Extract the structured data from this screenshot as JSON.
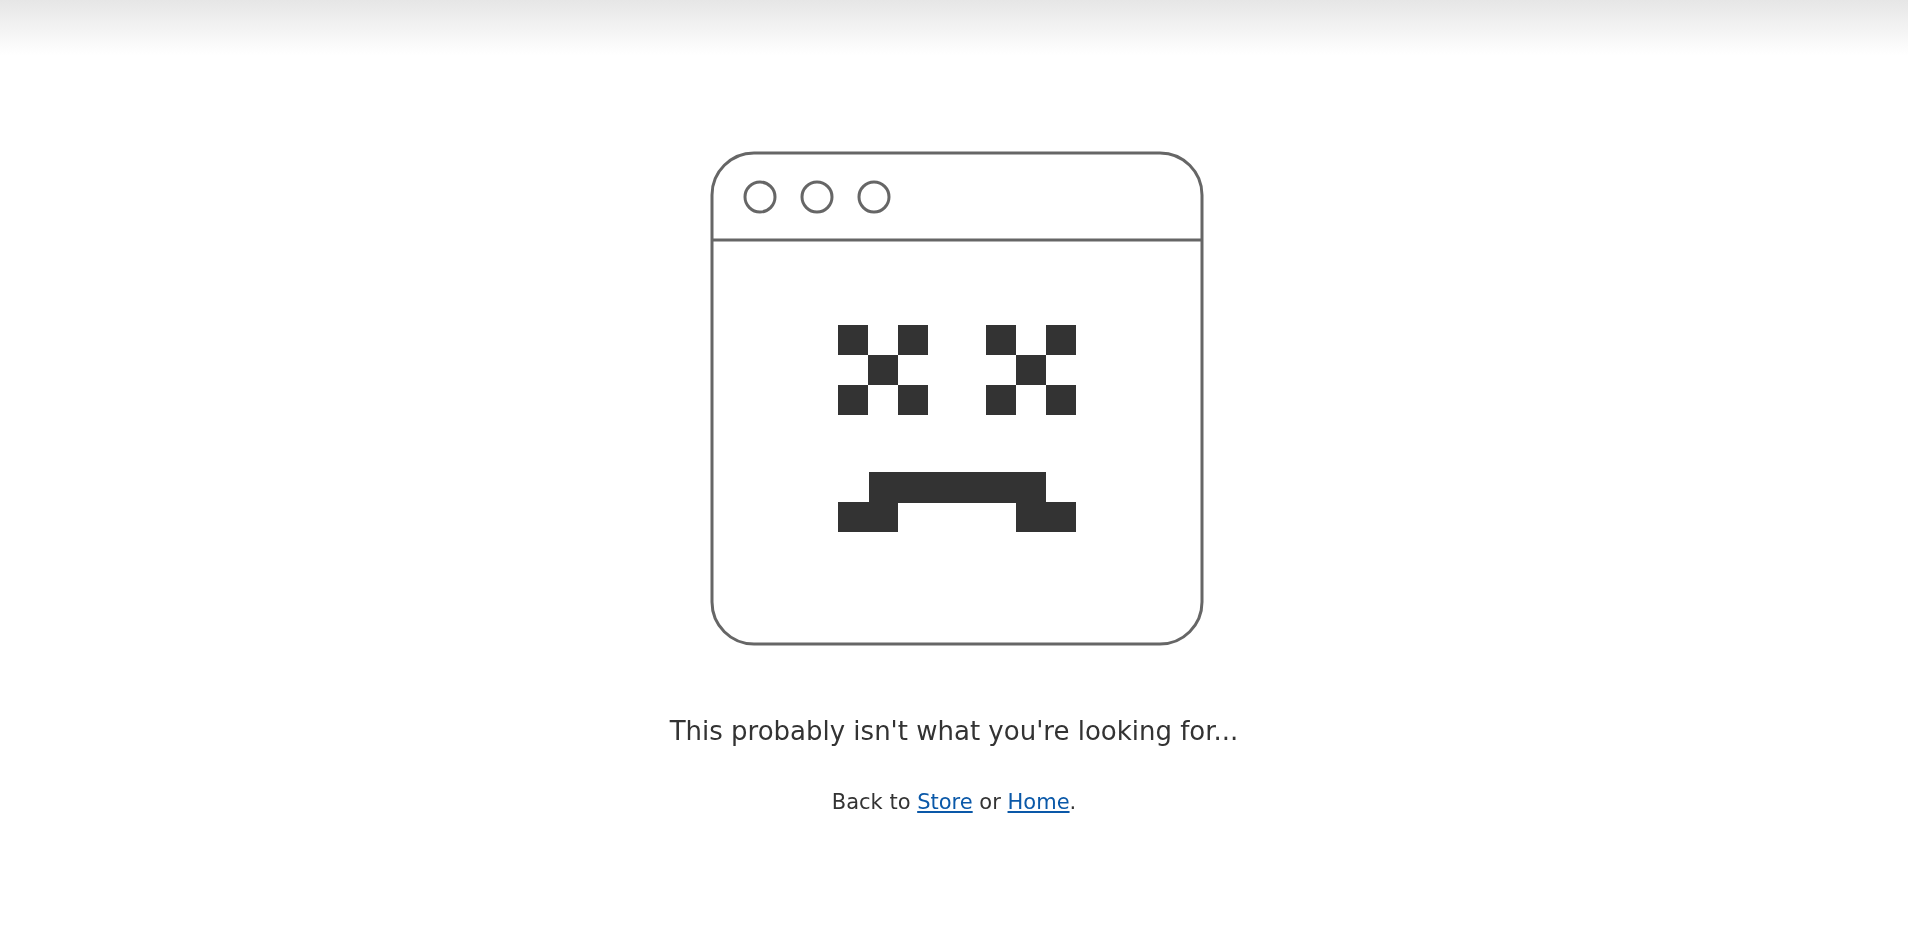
{
  "heading": "This probably isn't what you're looking for...",
  "back_line": [
    {
      "kind": "text",
      "text": "Back to "
    },
    {
      "kind": "link",
      "text": "Store"
    },
    {
      "kind": "text",
      "text": " or "
    },
    {
      "kind": "link",
      "text": "Home"
    },
    {
      "kind": "text",
      "text": "."
    }
  ]
}
